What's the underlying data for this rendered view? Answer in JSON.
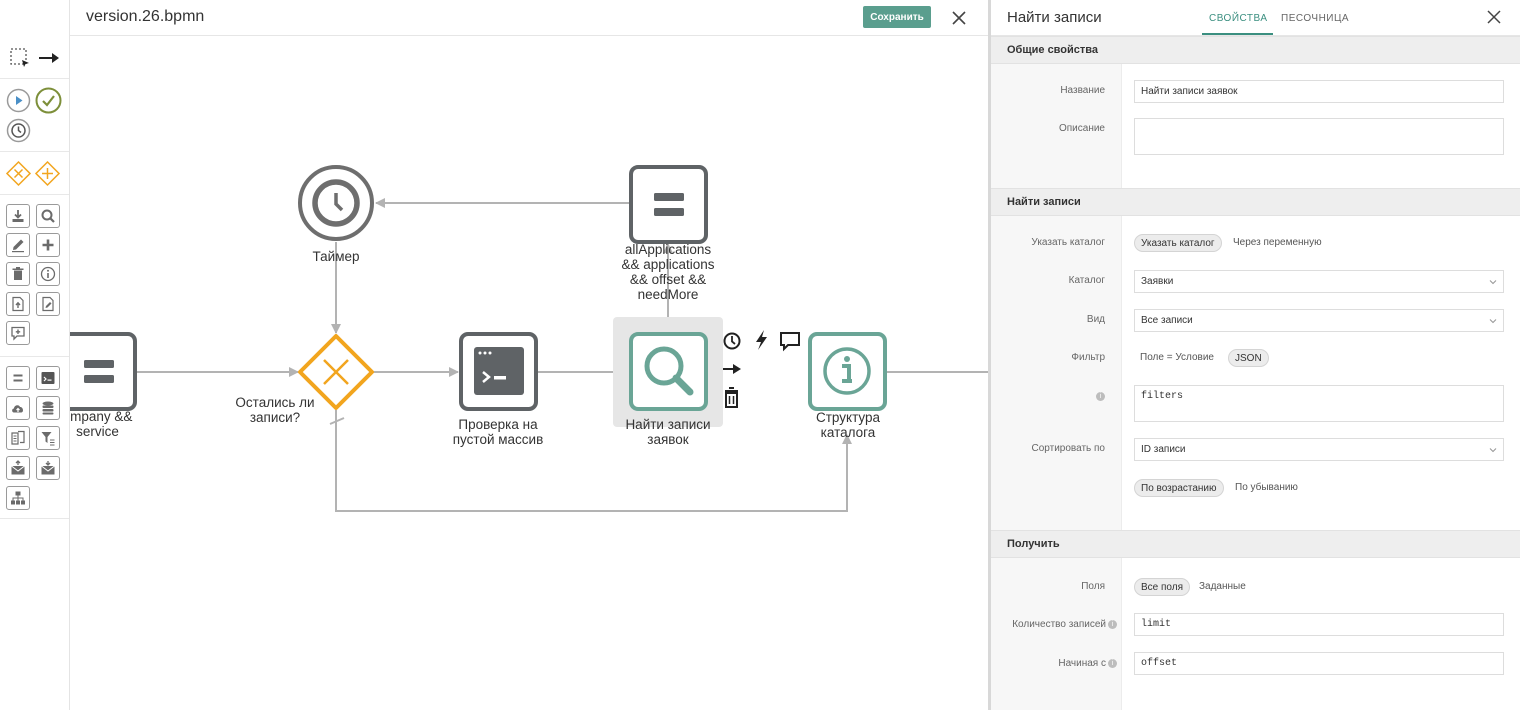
{
  "editor": {
    "file_name": "version.26.bpmn",
    "save_label": "Сохранить"
  },
  "toolbar": {
    "tools": [
      "lasso-tool",
      "connect-tool",
      "start-event",
      "end-event",
      "timer-event",
      "exclusive-gateway",
      "parallel-gateway",
      "import-task",
      "find-task",
      "edit-task",
      "create-task",
      "delete-task",
      "info-task",
      "upload-file-task",
      "edit-file-task",
      "message-task",
      "subprocess-task",
      "script-task",
      "cloud-task",
      "database-task",
      "document-task",
      "filter-task",
      "send-mail-task",
      "receive-mail-task",
      "org-structure-task"
    ]
  },
  "diagram": {
    "nodes": {
      "timer": "Таймер",
      "gateway": [
        "Остались ли",
        "записи?"
      ],
      "left_task": [
        "ompany &&",
        "service"
      ],
      "check_task": [
        "Проверка на",
        "пустой массив"
      ],
      "find_task": [
        "Найти записи",
        "заявок"
      ],
      "info_task": [
        "Структура",
        "каталога"
      ]
    },
    "flow_condition": [
      "allApplications",
      "&& applications",
      "&& offset &&",
      "needMore"
    ],
    "context_pad": [
      "timer-icon",
      "bolt-icon",
      "comment-icon",
      "arrow-right-icon",
      "trash-icon"
    ],
    "colors": {
      "task_gray": "#5f6366",
      "task_teal": "#6aa596",
      "gateway_orange": "#f2a51e",
      "timer_gray": "#6e6e6e",
      "flow": "#b3b3b3"
    }
  },
  "panel": {
    "title": "Найти записи",
    "tabs": {
      "properties": "СВОЙСТВА",
      "sandbox": "ПЕСОЧНИЦА"
    },
    "general": {
      "header": "Общие свойства",
      "name_label": "Название",
      "name_value": "Найти записи заявок",
      "description_label": "Описание",
      "description_value": ""
    },
    "find": {
      "header": "Найти записи",
      "catalog_mode_label": "Указать каталог",
      "catalog_mode_selected": "Указать каталог",
      "catalog_mode_other": "Через переменную",
      "catalog_label": "Каталог",
      "catalog_value": "Заявки",
      "view_label": "Вид",
      "view_value": "Все записи",
      "filter_label": "Фильтр",
      "filter_mode_condition": "Поле = Условие",
      "filter_mode_json": "JSON",
      "filter_value": "filters",
      "sort_label": "Сортировать по",
      "sort_value": "ID записи",
      "sort_asc": "По возрастанию",
      "sort_desc": "По убыванию"
    },
    "get": {
      "header": "Получить",
      "fields_label": "Поля",
      "fields_all": "Все поля",
      "fields_set": "Заданные",
      "count_label": "Количество записей",
      "count_value": "limit",
      "offset_label": "Начиная с",
      "offset_value": "offset"
    }
  }
}
